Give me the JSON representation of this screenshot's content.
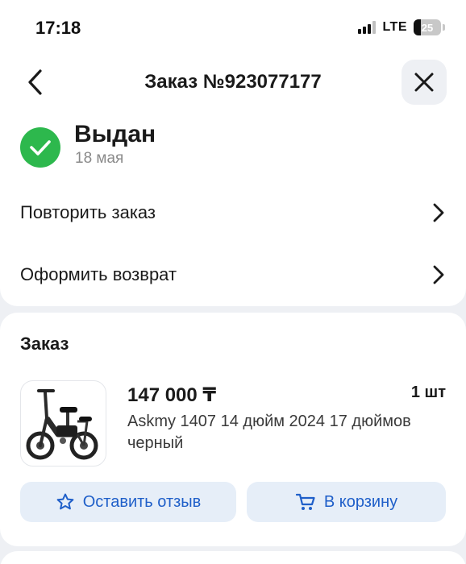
{
  "status_bar": {
    "time": "17:18",
    "network": "LTE",
    "battery_level": "25",
    "battery_fraction": 0.25
  },
  "header": {
    "title": "Заказ №923077177",
    "back_icon": "chevron-left-icon",
    "close_icon": "close-icon"
  },
  "order_status": {
    "title": "Выдан",
    "date": "18 мая",
    "icon": "check-circle-icon",
    "color": "#2db84d"
  },
  "actions": [
    {
      "label": "Повторить заказ",
      "icon": "chevron-right-icon"
    },
    {
      "label": "Оформить возврат",
      "icon": "chevron-right-icon"
    }
  ],
  "order": {
    "section_title": "Заказ",
    "item": {
      "price": "147 000 ₸",
      "quantity": "1 шт",
      "name": "Askmy 1407 14 дюйм 2024 17 дюймов черный",
      "image": "electric-bike-image"
    },
    "buttons": {
      "review_label": "Оставить отзыв",
      "review_icon": "star-icon",
      "cart_label": "В корзину",
      "cart_icon": "cart-icon"
    }
  },
  "colors": {
    "accent": "#1f5fc9",
    "button_bg": "#e6eef8",
    "success": "#2db84d",
    "background": "#eef0f4"
  }
}
